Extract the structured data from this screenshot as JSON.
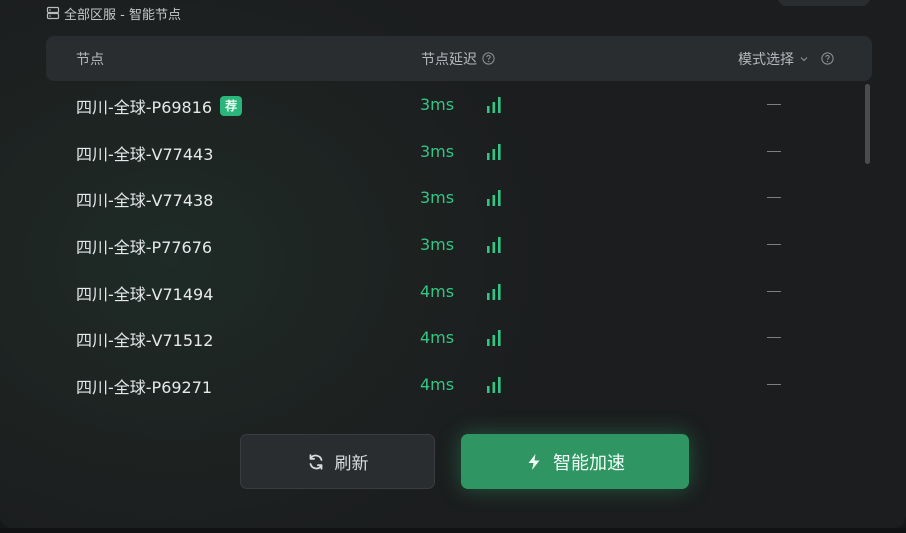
{
  "breadcrumb": {
    "text": "全部区服 - 智能节点",
    "icon": "server-icon"
  },
  "header": {
    "node_label": "节点",
    "latency_label": "节点延迟",
    "mode_label": "模式选择"
  },
  "rows": [
    {
      "name": "四川-全球-P69816",
      "badge": "荐",
      "latency": "3ms",
      "mode": "—"
    },
    {
      "name": "四川-全球-V77443",
      "latency": "3ms",
      "mode": "—"
    },
    {
      "name": "四川-全球-V77438",
      "latency": "3ms",
      "mode": "—"
    },
    {
      "name": "四川-全球-P77676",
      "latency": "3ms",
      "mode": "—"
    },
    {
      "name": "四川-全球-V71494",
      "latency": "4ms",
      "mode": "—"
    },
    {
      "name": "四川-全球-V71512",
      "latency": "4ms",
      "mode": "—"
    },
    {
      "name": "四川-全球-P69271",
      "latency": "4ms",
      "mode": "—"
    }
  ],
  "buttons": {
    "refresh_label": "刷新",
    "accelerate_label": "智能加速"
  },
  "colors": {
    "accent": "#2f9563",
    "latency_green": "#34c585",
    "badge": "#2bb57b"
  }
}
